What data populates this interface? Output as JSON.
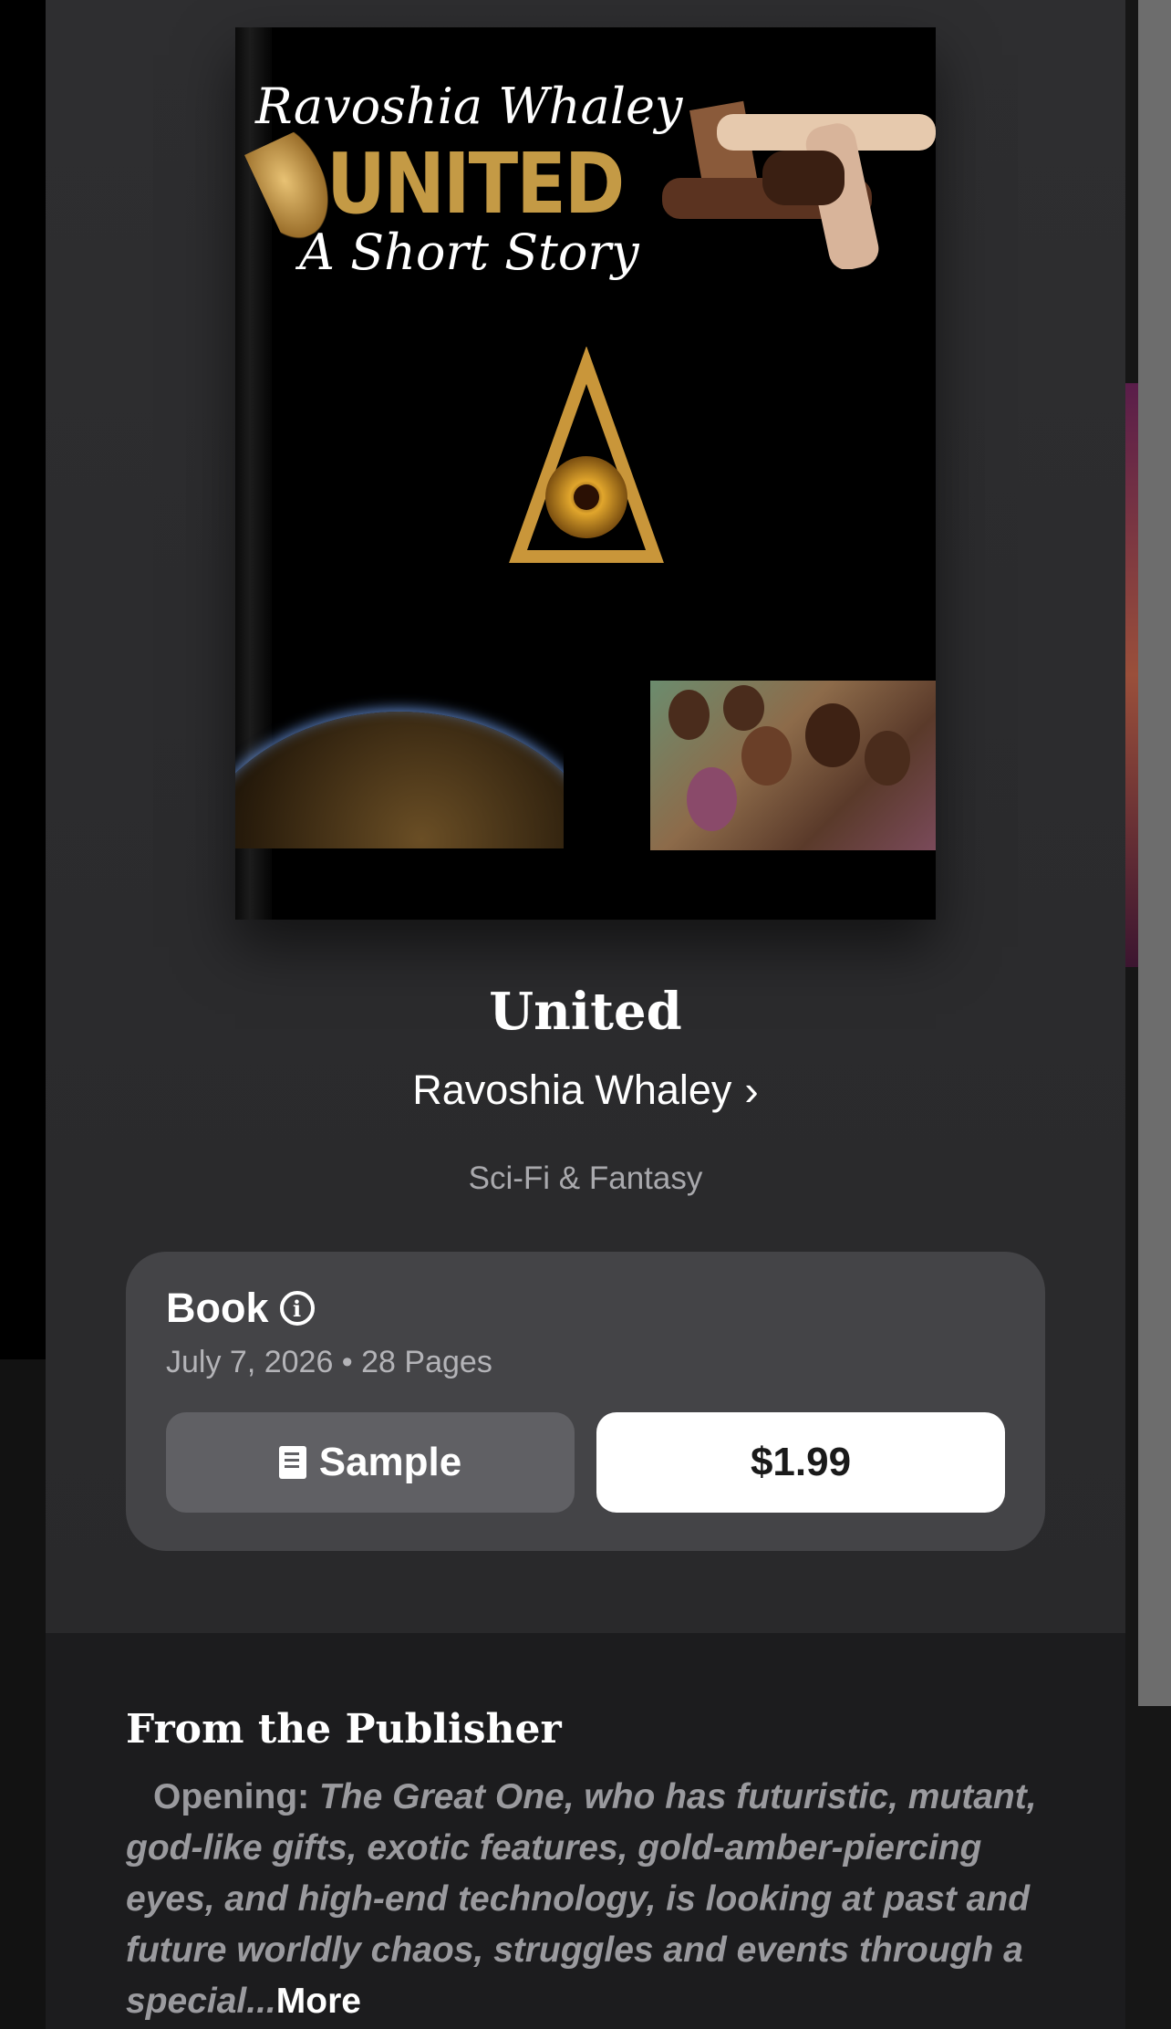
{
  "cover": {
    "author_script": "Ravoshia Whaley",
    "title_caps": "UNITED",
    "subtitle_script": "A Short Story"
  },
  "book": {
    "title": "United",
    "author": "Ravoshia Whaley",
    "genre": "Sci-Fi & Fantasy"
  },
  "buy_card": {
    "format": "Book",
    "meta": "July 7, 2026 • 28 Pages",
    "sample_label": "Sample",
    "price_label": "$1.99"
  },
  "publisher": {
    "heading": "From the Publisher",
    "lead": "Opening:",
    "body": "The Great One, who has futuristic, mutant, god-like gifts, exotic features, gold-amber-piercing eyes, and high-end technology, is looking at past and future worldly chaos, struggles and events through a special...",
    "more_label": "More"
  },
  "colors": {
    "sheet_bg": "#2a2a2c",
    "card_bg": "#444447",
    "cover_gold": "#c49a45",
    "publisher_bg": "#1c1c1e"
  }
}
